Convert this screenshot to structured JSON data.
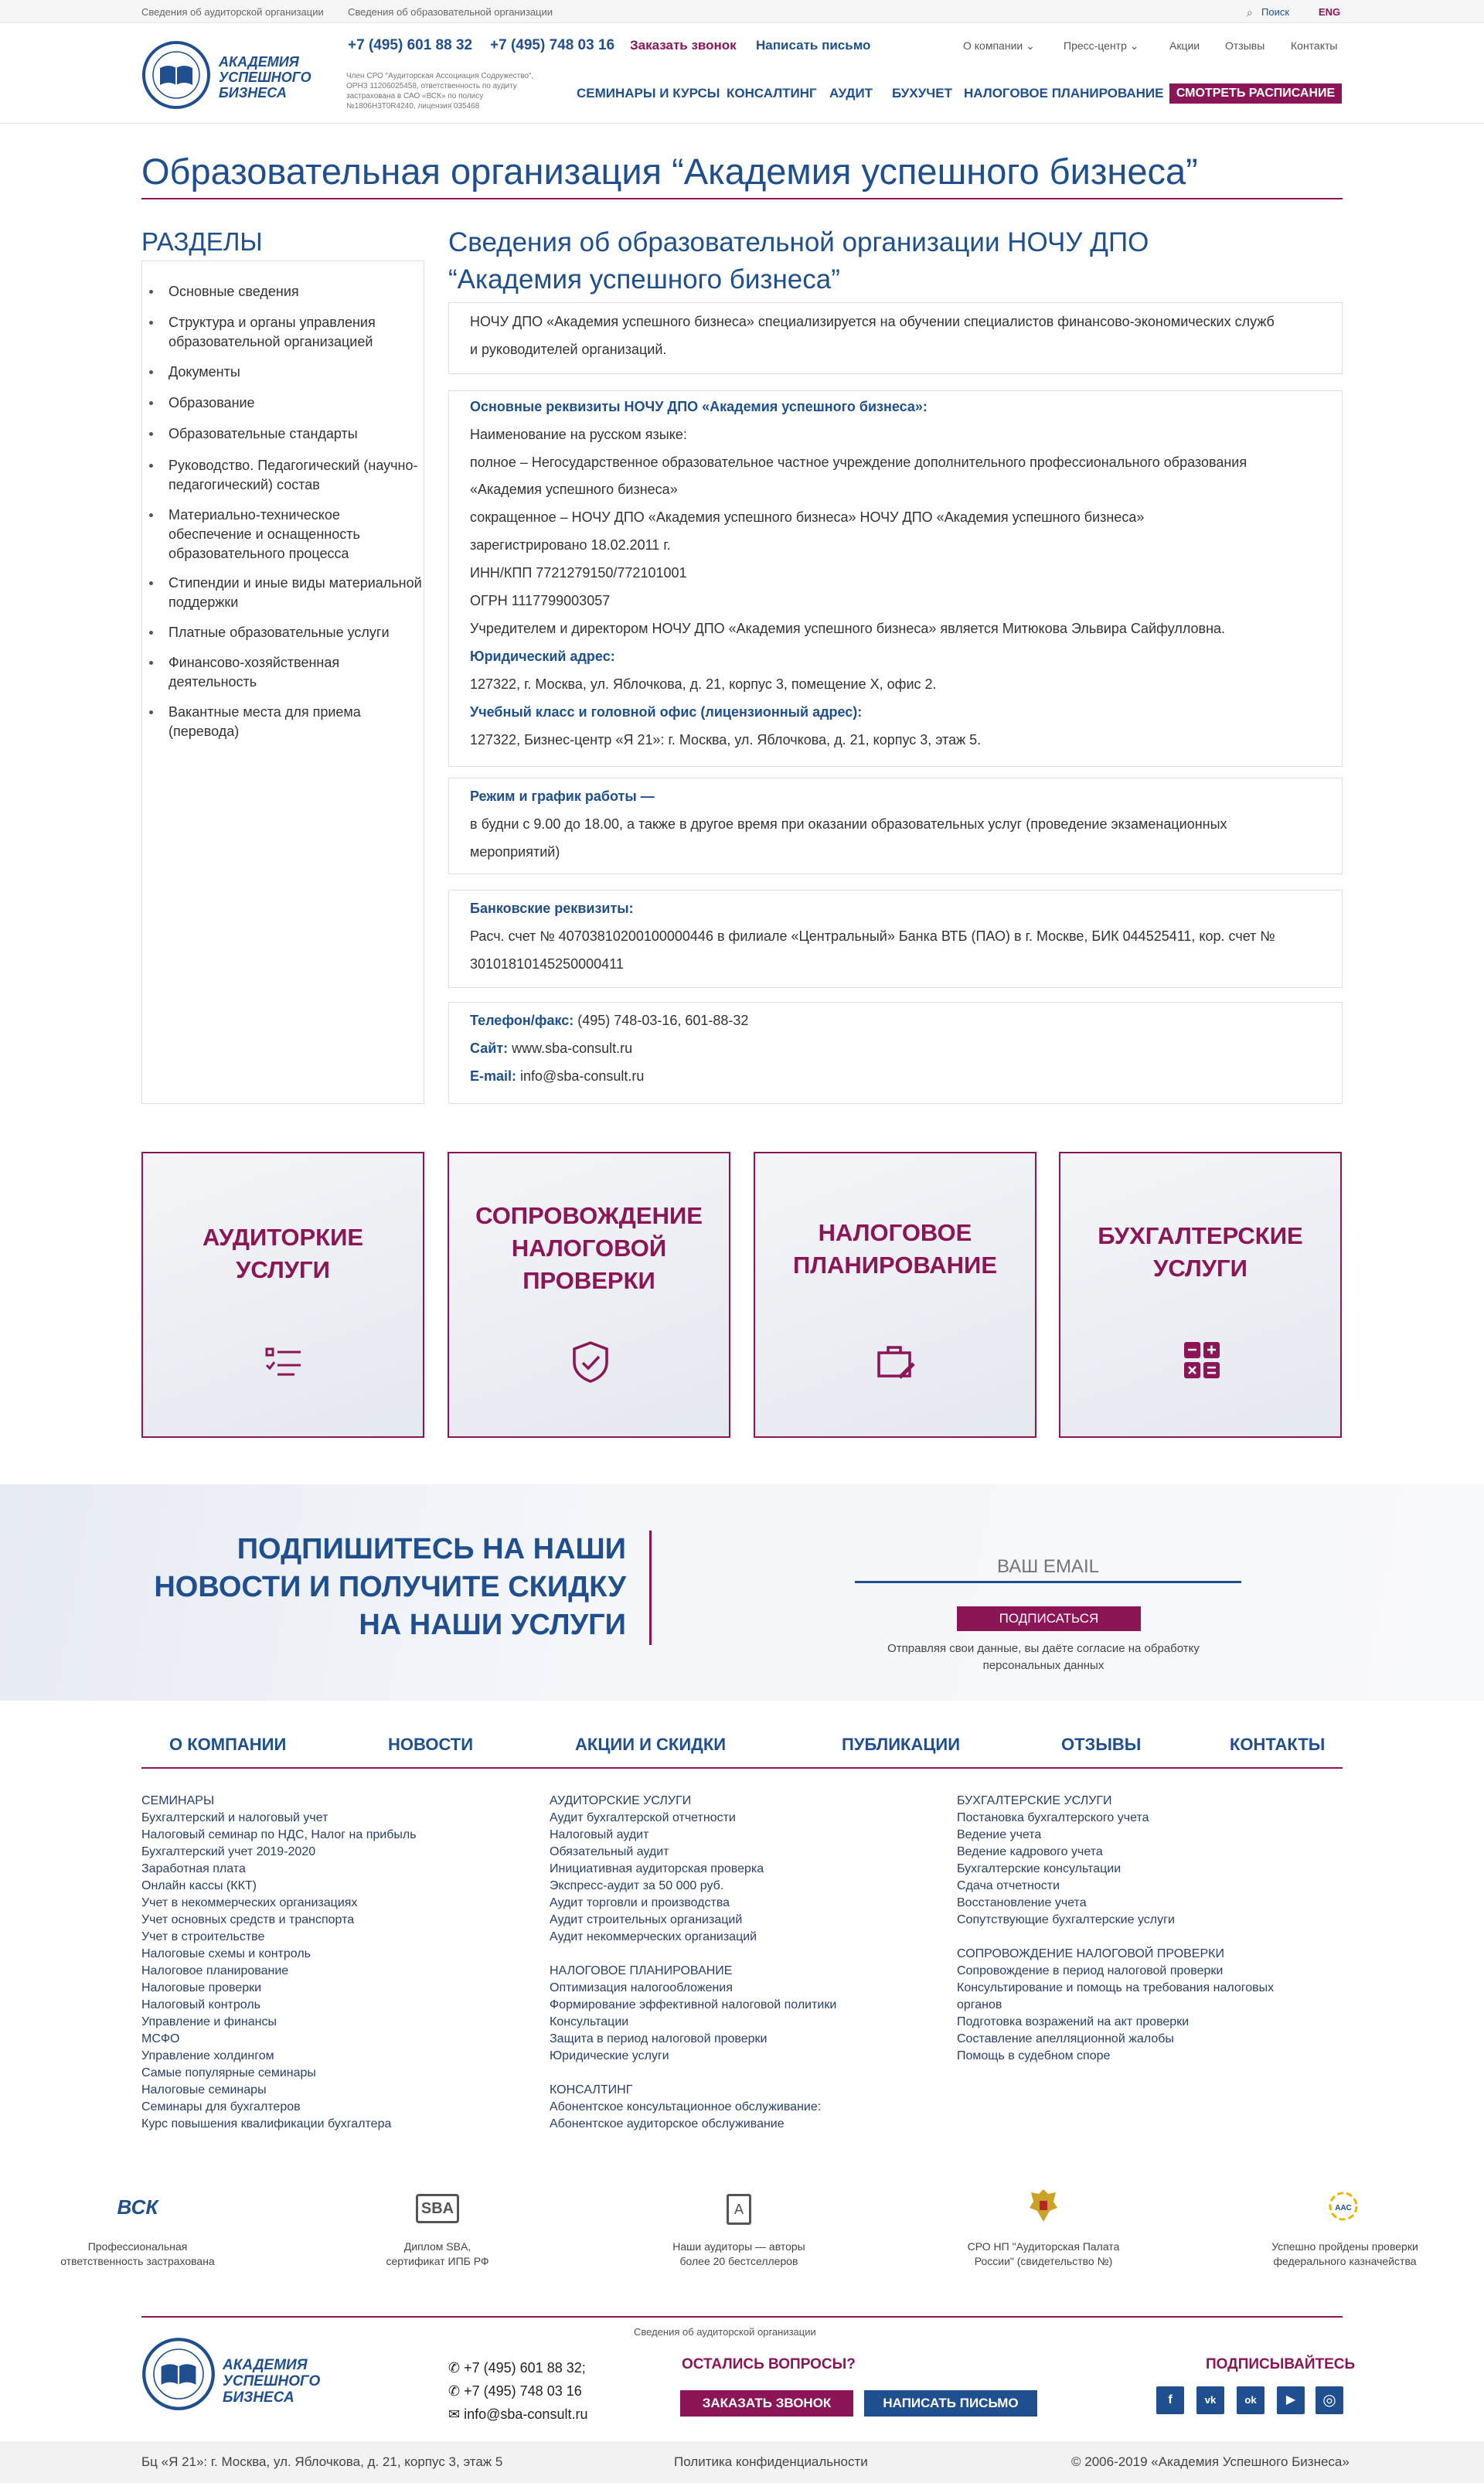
{
  "topbar": {
    "link1": "Сведения об аудиторской организации",
    "link2": "Сведения об образовательной организации",
    "search": "Поиск",
    "lang": "ENG"
  },
  "header": {
    "logo_line1": "АКАДЕМИЯ",
    "logo_line2": "УСПЕШНОГО",
    "logo_line3": "БИЗНЕСА",
    "sro_note": "Член СРО \"Аудиторская Ассоциация Содружество\", ОРНЗ 11206025458, ответственность по аудиту застрахована в САО «ВСК» по полису №1806Н3Т0R4240, лицензия 035468",
    "phone1": "+7 (495) 601 88 32",
    "phone2": "+7 (495) 748 03 16",
    "call_btn": "Заказать звонок",
    "mail_btn": "Написать письмо",
    "nav_top": [
      "О компании",
      "Пресс-центр",
      "Акции",
      "Отзывы",
      "Контакты"
    ],
    "nav_main": [
      "СЕМИНАРЫ И КУРСЫ",
      "КОНСАЛТИНГ",
      "АУДИТ",
      "БУХУЧЕТ",
      "НАЛОГОВОЕ ПЛАНИРОВАНИЕ"
    ],
    "schedule_btn": "СМОТРЕТЬ РАСПИСАНИЕ"
  },
  "page": {
    "title": "Образовательная организация “Академия успешного бизнеса”"
  },
  "sidebar": {
    "heading": "РАЗДЕЛЫ",
    "items": [
      "Основные сведения",
      "Структура и органы управления образовательной организацией",
      "Документы",
      "Образование",
      "Образовательные стандарты",
      "Руководство. Педагогический (научно-педагогический) состав",
      "Материально-техническое обеспечение и оснащенность образовательного процесса",
      "Стипендии и иные виды материальной поддержки",
      "Платные образовательные услуги",
      "Финансово-хозяйственная деятельность",
      "Вакантные места для приема (перевода)"
    ]
  },
  "content": {
    "heading_l1": "Сведения об образовательной организации НОЧУ ДПО",
    "heading_l2": "“Академия успешного бизнеса”",
    "intro_l1": "НОЧУ ДПО «Академия успешного бизнеса» специализируется на обучении специалистов финансово-экономических служб",
    "intro_l2": "и руководителей организаций.",
    "req_title": "Основные реквизиты НОЧУ ДПО «Академия успешного бизнеса»:",
    "req_l1": "Наименование на русском языке:",
    "req_l2": "полное – Негосударственное образовательное частное учреждение дополнительного профессионального образования",
    "req_l3": "«Академия успешного бизнеса»",
    "req_l4": "сокращенное – НОЧУ ДПО «Академия успешного бизнеса» НОЧУ ДПО «Академия успешного бизнеса»",
    "req_l5": "зарегистрировано 18.02.2011 г.",
    "req_l6": "ИНН/КПП 7721279150/772101001",
    "req_l7": "ОГРН 1117799003057",
    "req_l8": "Учредителем и директором НОЧУ ДПО «Академия успешного бизнеса» является Митюкова Эльвира Сайфулловна.",
    "legal_title": "Юридический адрес:",
    "legal_addr": "127322, г. Москва, ул. Яблочкова, д. 21, корпус 3, помещение X, офис 2.",
    "office_title": "Учебный класс и головной офис (лицензионный адрес):",
    "office_addr": "127322, Бизнес-центр «Я 21»: г. Москва, ул. Яблочкова, д. 21, корпус 3, этаж 5.",
    "hours_title": "Режим и график работы —",
    "hours_l1": "в будни с 9.00 до 18.00, а также в другое время при оказании образовательных услуг (проведение экзаменационных",
    "hours_l2": "мероприятий)",
    "bank_title": "Банковские реквизиты:",
    "bank_l1": "Расч. счет № 40703810200100000446 в филиале «Центральный» Банка ВТБ (ПАО) в г. Москве, БИК 044525411, кор. счет №",
    "bank_l2": "30101810145250000411",
    "phone_label": "Телефон/факс:",
    "phone_val": "(495) 748-03-16, 601-88-32",
    "site_label": "Сайт:",
    "site_val": "www.sba-consult.ru",
    "email_label": "E-mail:",
    "email_val": "info@sba-consult.ru"
  },
  "cards": [
    {
      "l1": "АУДИТОРКИЕ",
      "l2": "УСЛУГИ",
      "l3": "",
      "icon": "checklist-icon"
    },
    {
      "l1": "СОПРОВОЖДЕНИЕ",
      "l2": "НАЛОГОВОЙ",
      "l3": "ПРОВЕРКИ",
      "icon": "shield-check-icon"
    },
    {
      "l1": "НАЛОГОВОЕ",
      "l2": "ПЛАНИРОВАНИЕ",
      "l3": "",
      "icon": "briefcase-edit-icon"
    },
    {
      "l1": "БУХГАЛТЕРСКИЕ",
      "l2": "УСЛУГИ",
      "l3": "",
      "icon": "calculator-icon"
    }
  ],
  "subscribe": {
    "l1": "ПОДПИШИТЕСЬ НА НАШИ",
    "l2": "НОВОСТИ И ПОЛУЧИТЕ СКИДКУ",
    "l3": "НА НАШИ УСЛУГИ",
    "email_placeholder": "ВАШ EMAIL",
    "button": "ПОДПИСАТЬСЯ",
    "note_l1": "Отправляя свои данные, вы даёте согласие на обработку",
    "note_l2": "персональных данных"
  },
  "footer_nav": [
    "О КОМПАНИИ",
    "НОВОСТИ",
    "АКЦИИ И СКИДКИ",
    "ПУБЛИКАЦИИ",
    "ОТЗЫВЫ",
    "КОНТАКТЫ"
  ],
  "footer_col1": [
    "СЕМИНАРЫ",
    "Бухгалтерский и налоговый учет",
    "Налоговый семинар по НДС, Налог на прибыль",
    "Бухгалтерский учет 2019-2020",
    "Заработная плата",
    "Онлайн кассы (ККТ)",
    "Учет в некоммерческих организациях",
    "Учет основных средств и транспорта",
    "Учет в строительстве",
    "Налоговые схемы и контроль",
    "Налоговое планирование",
    "Налоговые проверки",
    "Налоговый контроль",
    "Управление и финансы",
    "МСФО",
    "Управление холдингом",
    "Самые популярные семинары",
    "Налоговые семинары",
    "Семинары для бухгалтеров",
    "Курс повышения квалификации бухгалтера"
  ],
  "footer_col2": [
    "АУДИТОРСКИЕ УСЛУГИ",
    "Аудит бухгалтерской отчетности",
    "Налоговый аудит",
    "Обязательный аудит",
    "Инициативная аудиторская проверка",
    "Экспресс-аудит за 50 000 руб.",
    "Аудит торговли и производства",
    "Аудит строительных организаций",
    "Аудит некоммерческих организаций",
    "",
    "НАЛОГОВОЕ ПЛАНИРОВАНИЕ",
    "Оптимизация налогообложения",
    "Формирование эффективной налоговой политики",
    "Консультации",
    "Защита в период налоговой проверки",
    "Юридические услуги",
    "",
    "КОНСАЛТИНГ",
    "Абонентское консультационное обслуживание:",
    "Абонентское аудиторское обслуживание"
  ],
  "footer_col3": [
    "БУХГАЛТЕРСКИЕ УСЛУГИ",
    "Постановка бухгалтерского учета",
    "Ведение учета",
    "Ведение кадрового учета",
    "Бухгалтерские консультации",
    "Сдача отчетности",
    "Восстановление учета",
    "Сопутствующие бухгалтерские услуги",
    "",
    "СОПРОВОЖДЕНИЕ НАЛОГОВОЙ ПРОВЕРКИ",
    "Сопровождение в период налоговой проверки",
    "Консультирование и помощь на требования налоговых",
    "органов",
    "Подготовка возражений на акт проверки",
    "Составление апелляционной жалобы",
    "Помощь в судебном споре"
  ],
  "badges": [
    {
      "logo": "ВСК",
      "l1": "Профессиональная",
      "l2": "ответственность застрахована"
    },
    {
      "logo": "SBA",
      "l1": "Диплом SBA,",
      "l2": "сертификат ИПБ РФ"
    },
    {
      "logo": "A",
      "l1": "Наши аудиторы — авторы",
      "l2": "более 20 бестселлеров"
    },
    {
      "logo": "ГЕРБ",
      "l1": "СРО НП \"Аудиторская Палата",
      "l2": "России\" (свидетельство №)"
    },
    {
      "logo": "ААС",
      "l1": "Успешно пройдены проверки",
      "l2": "федерального казначейства"
    }
  ],
  "footer": {
    "small_link": "Сведения об аудиторской организации",
    "phone1": "+7 (495) 601 88 32;",
    "phone2": "+7 (495) 748 03 16",
    "email": "info@sba-consult.ru",
    "questions": "ОСТАЛИСЬ ВОПРОСЫ?",
    "call_btn": "ЗАКАЗАТЬ ЗВОНОК",
    "mail_btn": "НАПИСАТЬ ПИСЬМО",
    "subscribe_label": "ПОДПИСЫВАЙТЕСЬ",
    "social": [
      "f",
      "vk",
      "ok",
      "▶",
      "◎"
    ],
    "address": "Бц «Я 21»: г. Москва, ул. Яблочкова, д. 21, корпус 3, этаж 5",
    "privacy": "Политика конфиденциальности",
    "copyright": "© 2006-2019 «Академия Успешного Бизнеса»"
  },
  "colors": {
    "brand_blue": "#1f4f8f",
    "brand_magenta": "#8b1556"
  }
}
